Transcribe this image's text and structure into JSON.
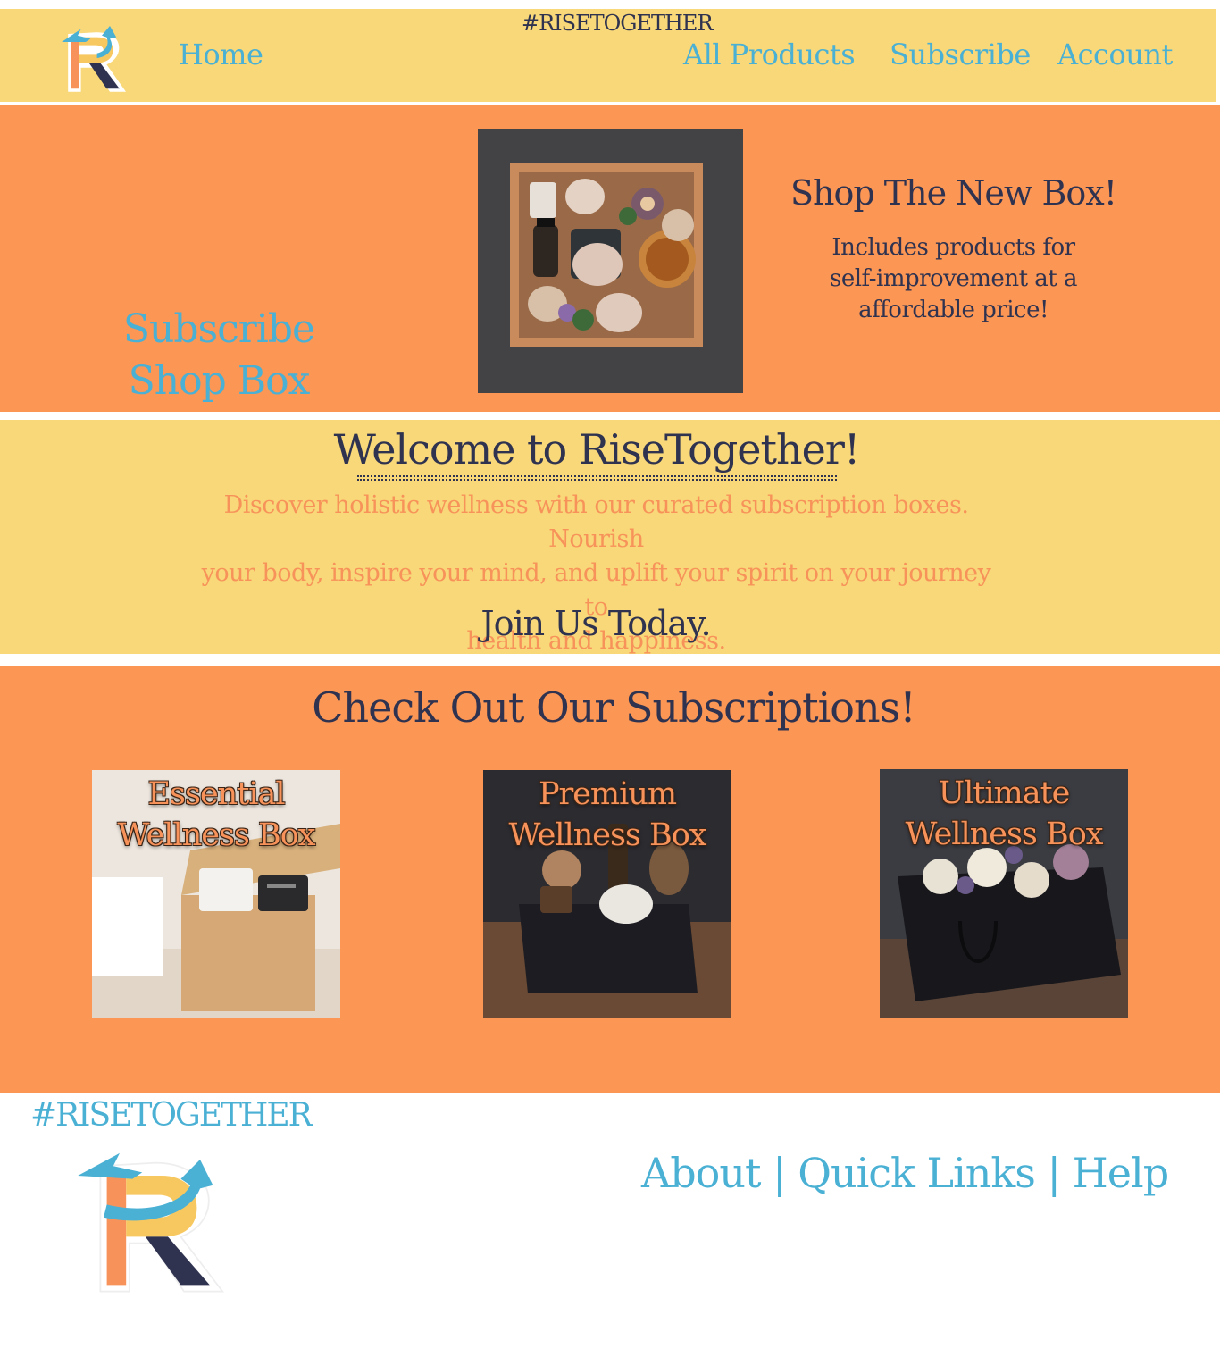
{
  "header": {
    "tagline": "#RISETOGETHER",
    "nav": {
      "home": "Home",
      "all_products": "All Products",
      "subscribe": "Subscribe",
      "account": "Account"
    }
  },
  "hero": {
    "cta_line1": "Subscribe",
    "cta_line2": "Shop Box",
    "promo_title": "Shop The New Box!",
    "promo_line1": "Includes products for",
    "promo_line2": "self-improvement at a",
    "promo_line3": "affordable price!"
  },
  "welcome": {
    "title": "Welcome to RiseTogether!",
    "desc_line1": "Discover holistic wellness with our curated subscription boxes. Nourish",
    "desc_line2": "your body, inspire your mind, and uplift your spirit on your journey to",
    "desc_line3": "health and happiness.",
    "join": "Join Us Today."
  },
  "subscriptions": {
    "title": "Check Out Our Subscriptions!",
    "cards": [
      {
        "line1": "Essential",
        "line2": "Wellness Box"
      },
      {
        "line1": "Premium",
        "line2": "Wellness Box"
      },
      {
        "line1": "Ultimate",
        "line2": "Wellness Box"
      }
    ]
  },
  "footer": {
    "tagline": "#RISETOGETHER",
    "about": "About",
    "sep1": " | ",
    "quick_links": "Quick Links",
    "sep2": " | ",
    "help": "Help"
  },
  "colors": {
    "yellow": "#f8d878",
    "orange": "#fb9655",
    "navy": "#2f3350",
    "blue": "#4ab0d4"
  },
  "icons": [
    "risetogether-logo-icon"
  ]
}
